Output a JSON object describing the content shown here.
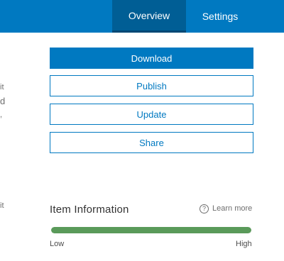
{
  "tabs": {
    "overview": "Overview",
    "settings": "Settings"
  },
  "left_fragments": [
    "it",
    "d",
    ",",
    "it"
  ],
  "actions": {
    "download": "Download",
    "publish": "Publish",
    "update": "Update",
    "share": "Share"
  },
  "item_information": {
    "title": "Item Information",
    "learn_more": "Learn more",
    "help_icon": "question-circle-icon",
    "level_fraction": 1.0,
    "low_label": "Low",
    "high_label": "High"
  },
  "colors": {
    "accent": "#0079c1",
    "meter": "#5a9a5a"
  }
}
